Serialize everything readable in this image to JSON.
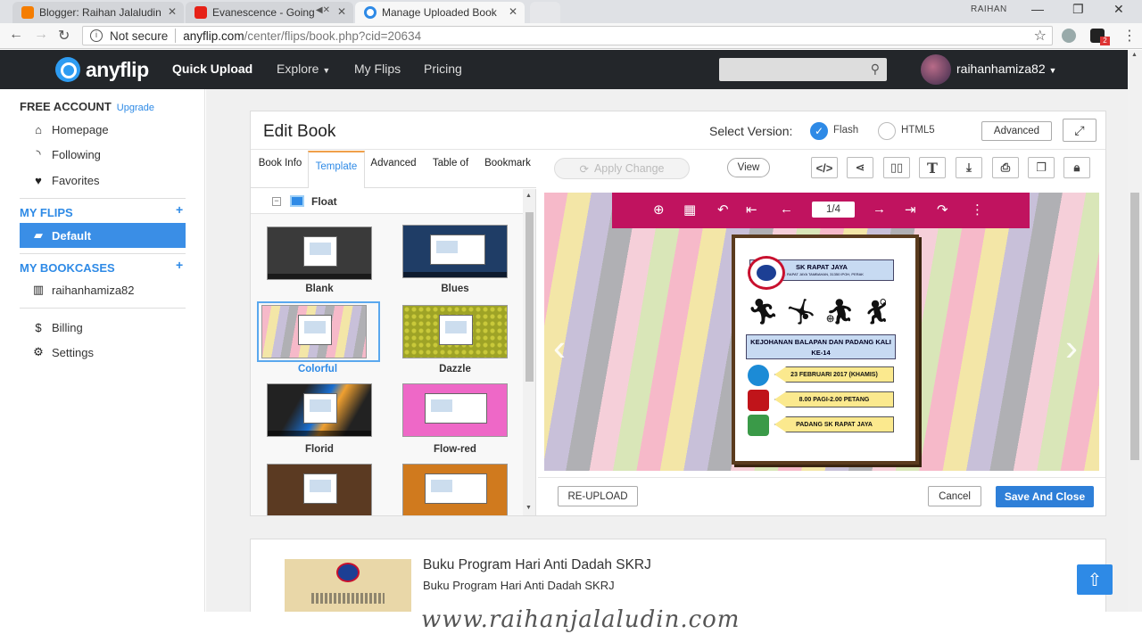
{
  "browser": {
    "tabs": [
      {
        "title": "Blogger: Raihan Jalaludin"
      },
      {
        "title": "Evanescence - Going"
      },
      {
        "title": "Manage Uploaded Book"
      }
    ],
    "window_user": "RAIHAN",
    "security": "Not secure",
    "url_host": "anyflip.com",
    "url_path": "/center/flips/book.php?cid=20634",
    "ext_badge": "2"
  },
  "header": {
    "logo": "anyflip",
    "nav": [
      "Quick Upload",
      "Explore",
      "My Flips",
      "Pricing"
    ],
    "username": "raihanhamiza82"
  },
  "sidebar": {
    "account": "FREE ACCOUNT",
    "upgrade": "Upgrade",
    "items": [
      "Homepage",
      "Following",
      "Favorites"
    ],
    "my_flips": "MY FLIPS",
    "default": "Default",
    "my_bookcases": "MY BOOKCASES",
    "bookcase_user": "raihanhamiza82",
    "billing": "Billing",
    "settings": "Settings"
  },
  "edit": {
    "title": "Edit Book",
    "select_version": "Select Version:",
    "flash": "Flash",
    "html5": "HTML5",
    "advanced_btn": "Advanced",
    "tabs": [
      "Book Info",
      "Template",
      "Advanced",
      "Table of",
      "Bookmark"
    ],
    "group": "Float",
    "templates": [
      "Blank",
      "Blues",
      "Colorful",
      "Dazzle",
      "Florid",
      "Flow-red"
    ],
    "apply": "Apply Change",
    "view": "View",
    "page_indicator": "1/4",
    "reupload": "RE-UPLOAD",
    "cancel": "Cancel",
    "save": "Save And Close"
  },
  "poster": {
    "school": "SK RAPAT JAYA",
    "address": "KG. RAPAT JAYA TAMBAHAN, 31350 IPOH, PERAK",
    "event": "KEJOHANAN BALAPAN DAN PADANG KALI KE-14",
    "date": "23 FEBRUARI 2017 (KHAMIS)",
    "time": "8.00 PAGI-2.00 PETANG",
    "venue": "PADANG SK RAPAT JAYA"
  },
  "book": {
    "title": "Buku Program Hari Anti Dadah SKRJ",
    "subtitle": "Buku Program Hari Anti Dadah SKRJ"
  },
  "watermark": "www.raihanjalaludin.com"
}
